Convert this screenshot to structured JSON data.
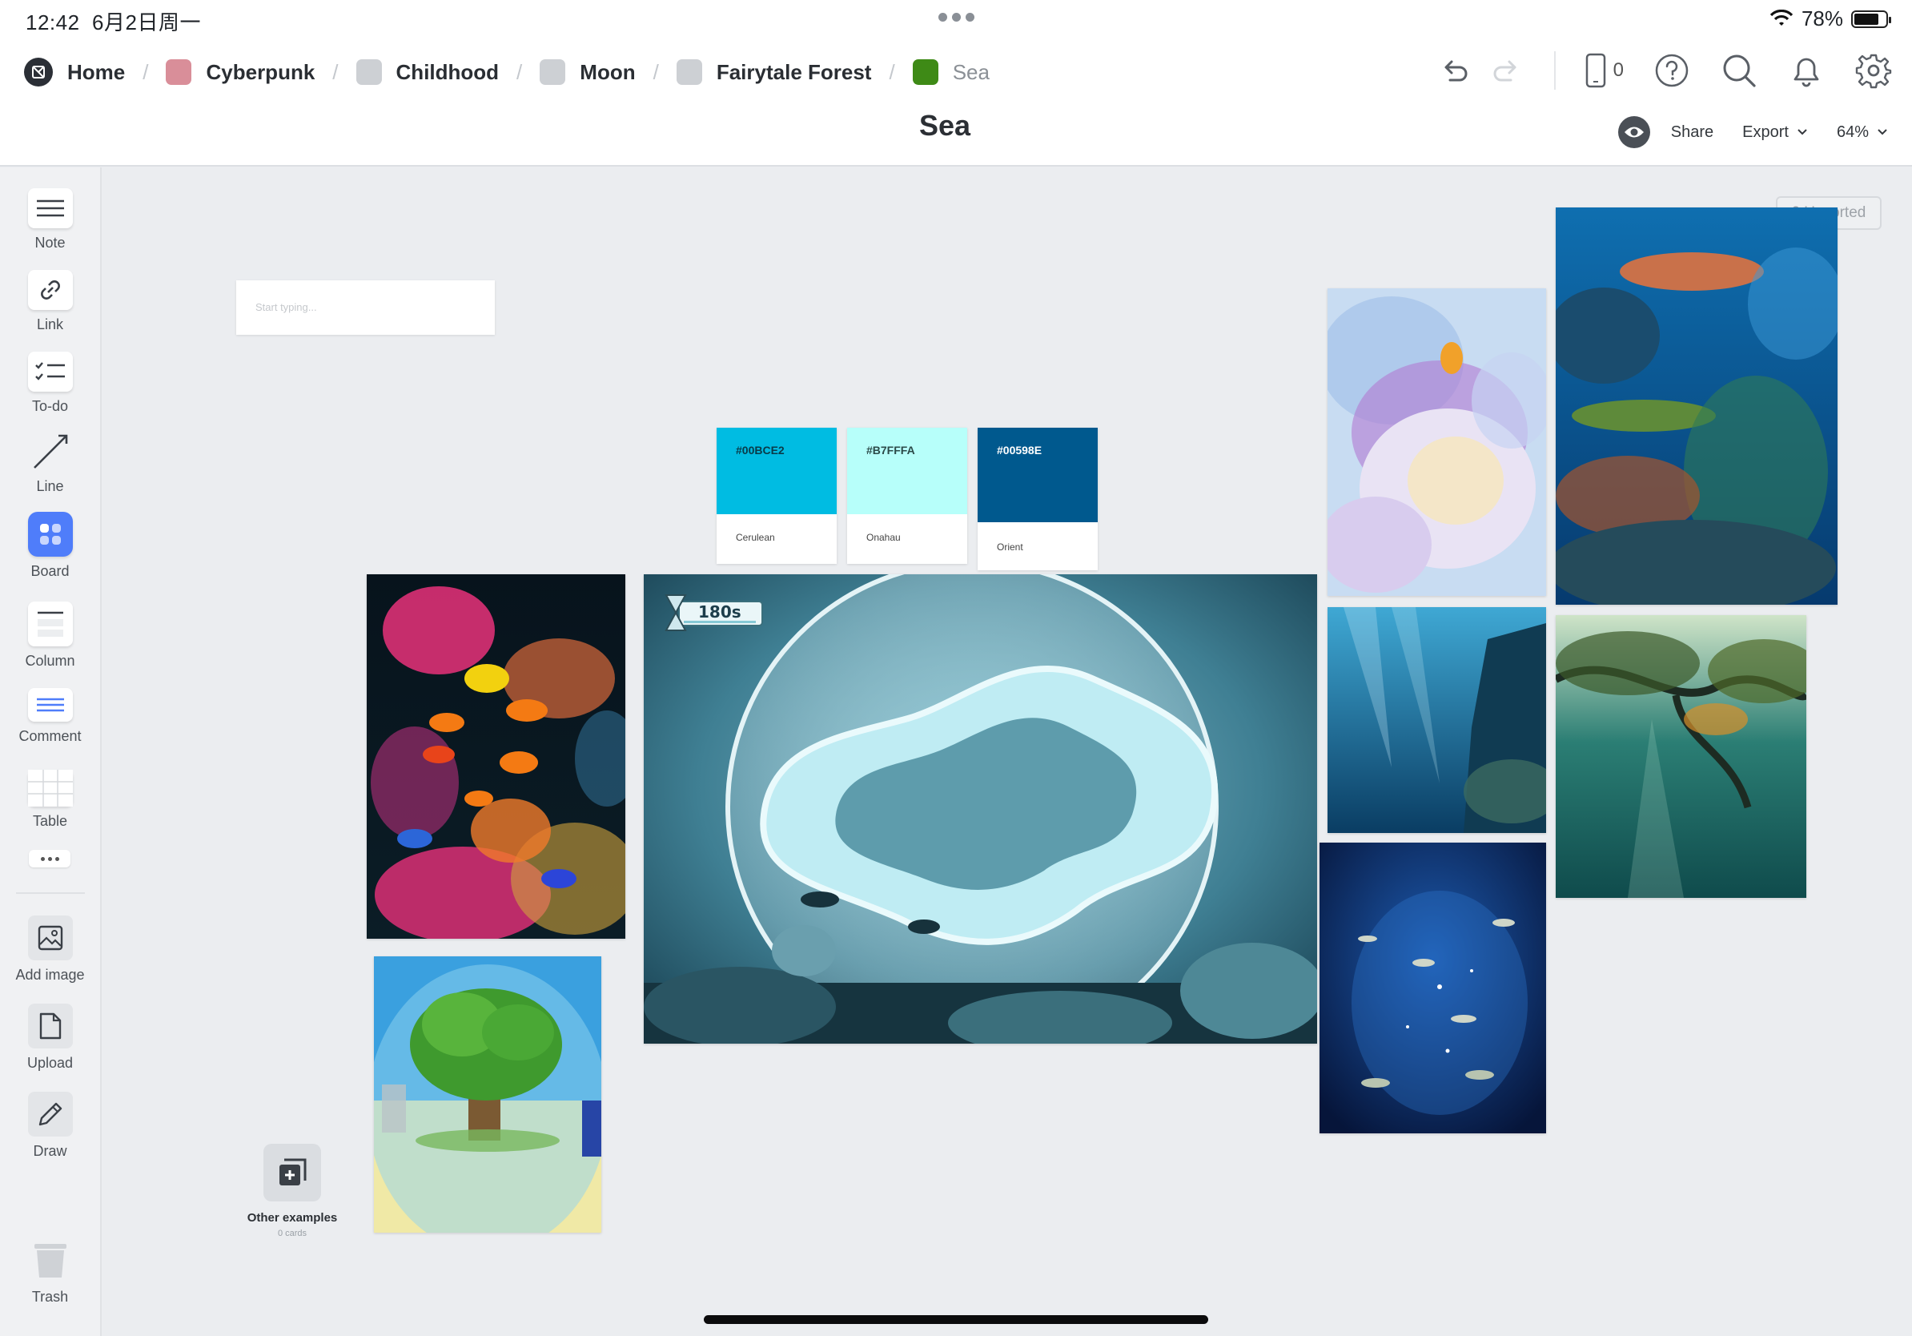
{
  "status_bar": {
    "time": "12:42",
    "date": "6月2日周一",
    "battery": "78%"
  },
  "breadcrumb": {
    "items": [
      {
        "label": "Home",
        "color": "#2b2f36"
      },
      {
        "label": "Cyberpunk",
        "color": "#d98e99"
      },
      {
        "label": "Childhood",
        "color": "#cdd0d4"
      },
      {
        "label": "Moon",
        "color": "#cdd0d4"
      },
      {
        "label": "Fairytale Forest",
        "color": "#cdd0d4"
      },
      {
        "label": "Sea",
        "color": "#3e8a16"
      }
    ]
  },
  "header": {
    "device_count": "0",
    "title": "Sea",
    "share_label": "Share",
    "export_label": "Export",
    "zoom": "64%",
    "icons": [
      "undo-icon",
      "redo-icon",
      "device-icon",
      "help-icon",
      "search-icon",
      "bell-icon",
      "gear-icon"
    ]
  },
  "sidebar": {
    "tools": [
      {
        "label": "Note",
        "icon": "note-icon"
      },
      {
        "label": "Link",
        "icon": "link-icon"
      },
      {
        "label": "To-do",
        "icon": "todo-icon"
      },
      {
        "label": "Line",
        "icon": "line-icon"
      },
      {
        "label": "Board",
        "icon": "board-icon"
      },
      {
        "label": "Column",
        "icon": "column-icon"
      },
      {
        "label": "Comment",
        "icon": "comment-icon"
      },
      {
        "label": "Table",
        "icon": "table-icon"
      },
      {
        "label": "Add image",
        "icon": "image-icon"
      },
      {
        "label": "Upload",
        "icon": "upload-icon"
      },
      {
        "label": "Draw",
        "icon": "pencil-icon"
      },
      {
        "label": "Trash",
        "icon": "trash-icon"
      }
    ]
  },
  "canvas": {
    "unsorted_count": "0",
    "unsorted_label": "Unsorted",
    "note_placeholder": "Start typing...",
    "swatches": [
      {
        "hex": "#00BCE2",
        "name": "Cerulean",
        "text_color": "#0a3a48"
      },
      {
        "hex": "#B7FFFA",
        "name": "Onahau",
        "text_color": "#2b4a48"
      },
      {
        "hex": "#00598E",
        "name": "Orient",
        "text_color": "#ffffff"
      }
    ],
    "timer_text": "180s",
    "other_examples": {
      "title": "Other examples",
      "subtitle": "0 cards"
    }
  }
}
